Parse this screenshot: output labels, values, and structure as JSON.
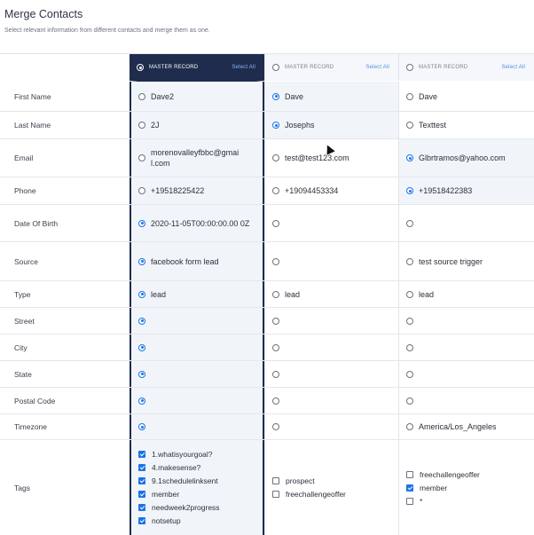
{
  "header": {
    "title": "Merge Contacts",
    "subtitle": "Select relevant information from different contacts and merge them as one."
  },
  "columns": [
    {
      "label": "MASTER RECORD",
      "select_all": "Select All",
      "master": true
    },
    {
      "label": "MASTER RECORD",
      "select_all": "Select All",
      "master": false
    },
    {
      "label": "MASTER RECORD",
      "select_all": "Select All",
      "master": false
    }
  ],
  "rows": {
    "first_name": {
      "label": "First Name",
      "values": [
        "Dave2",
        "Dave",
        "Dave"
      ],
      "selected": 1
    },
    "last_name": {
      "label": "Last Name",
      "values": [
        "2J",
        "Josephs",
        "Texttest"
      ],
      "selected": 1
    },
    "email": {
      "label": "Email",
      "values": [
        "morenovalleyfbbc@gmai l.com",
        "test@test123.com",
        "Glbrtramos@yahoo.com"
      ],
      "selected": 2
    },
    "phone": {
      "label": "Phone",
      "values": [
        "+19518225422",
        "+19094453334",
        "+19518422383"
      ],
      "selected": 2
    },
    "dob": {
      "label": "Date Of Birth",
      "values": [
        "2020-11-05T00:00:00.00 0Z",
        "",
        ""
      ],
      "selected": 0
    },
    "source": {
      "label": "Source",
      "values": [
        "facebook form lead",
        "",
        "test source trigger"
      ],
      "selected": 0
    },
    "type": {
      "label": "Type",
      "values": [
        "lead",
        "lead",
        "lead"
      ],
      "selected": 0
    },
    "street": {
      "label": "Street",
      "values": [
        "",
        "",
        ""
      ],
      "selected": 0
    },
    "city": {
      "label": "City",
      "values": [
        "",
        "",
        ""
      ],
      "selected": 0
    },
    "state": {
      "label": "State",
      "values": [
        "",
        "",
        ""
      ],
      "selected": 0
    },
    "postal_code": {
      "label": "Postal Code",
      "values": [
        "",
        "",
        ""
      ],
      "selected": 0
    },
    "timezone": {
      "label": "Timezone",
      "values": [
        "",
        "",
        "America/Los_Angeles"
      ],
      "selected": 0
    },
    "tags": {
      "label": "Tags",
      "col1": [
        {
          "name": "1.whatisyourgoal?",
          "checked": true
        },
        {
          "name": "4.makesense?",
          "checked": true
        },
        {
          "name": "9.1schedulelinksent",
          "checked": true
        },
        {
          "name": "member",
          "checked": true
        },
        {
          "name": "needweek2progress",
          "checked": true
        },
        {
          "name": "notsetup",
          "checked": true
        }
      ],
      "col2": [
        {
          "name": "prospect",
          "checked": false
        },
        {
          "name": "freechallengeoffer",
          "checked": false
        }
      ],
      "col3": [
        {
          "name": "freechallengeoffer",
          "checked": false
        },
        {
          "name": "member",
          "checked": true
        },
        {
          "name": "*",
          "checked": false
        }
      ]
    }
  },
  "colors": {
    "master_header": "#1f2c4d",
    "selected_bg": "#f1f5fa",
    "accent": "#1a73e8"
  }
}
